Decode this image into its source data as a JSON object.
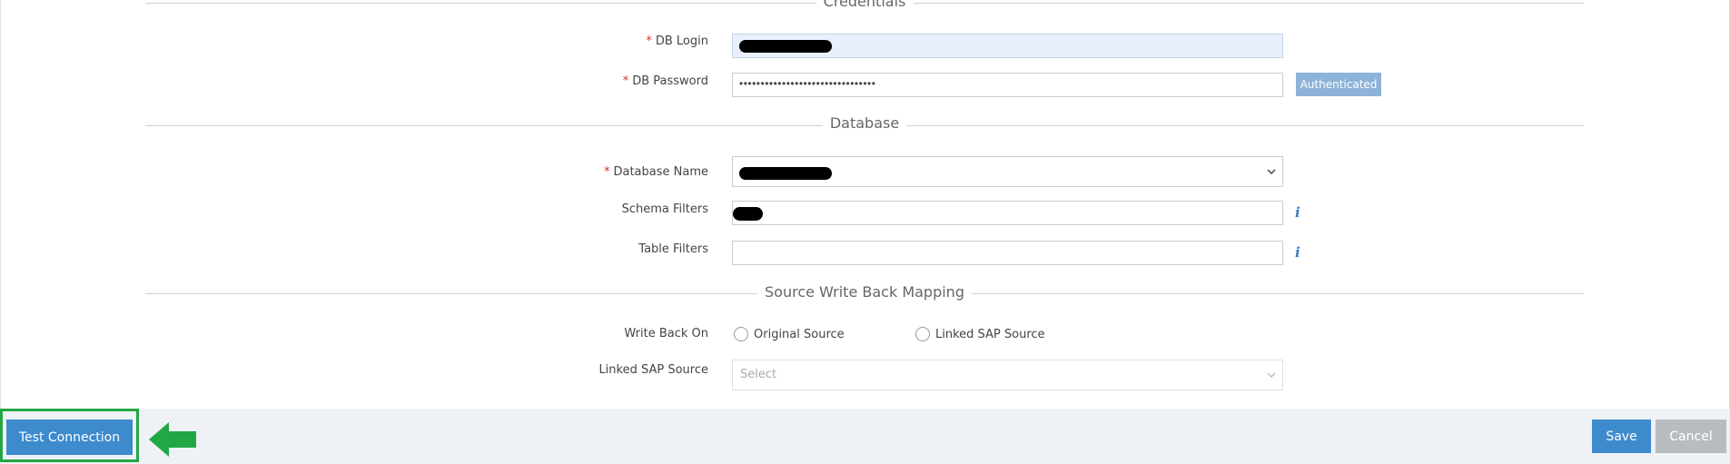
{
  "sections": {
    "credentials": "Credentials",
    "database": "Database",
    "write_back": "Source Write Back Mapping"
  },
  "fields": {
    "db_login": {
      "required": "*",
      "label": "DB Login"
    },
    "db_password": {
      "required": "*",
      "label": "DB Password",
      "value": "••••••••••••••••••••••••••••••••"
    },
    "database_name": {
      "required": "*",
      "label": "Database Name"
    },
    "schema_filters": {
      "label": "Schema Filters"
    },
    "table_filters": {
      "label": "Table Filters"
    },
    "write_back_on": {
      "label": "Write Back On"
    },
    "linked_sap_source": {
      "label": "Linked SAP Source",
      "placeholder": "Select"
    }
  },
  "radios": {
    "original": "Original Source",
    "linked": "Linked SAP Source"
  },
  "buttons": {
    "authenticated": "Authenticated",
    "test_connection": "Test Connection",
    "save": "Save",
    "cancel": "Cancel"
  },
  "icons": {
    "info": "i",
    "dropdown": "chevron-down-icon",
    "arrow": "arrow-left-icon"
  },
  "colors": {
    "primary": "#3d8bcd",
    "authenticated": "#8db3d8",
    "highlight_border": "#22a745",
    "required": "#d9342b"
  }
}
